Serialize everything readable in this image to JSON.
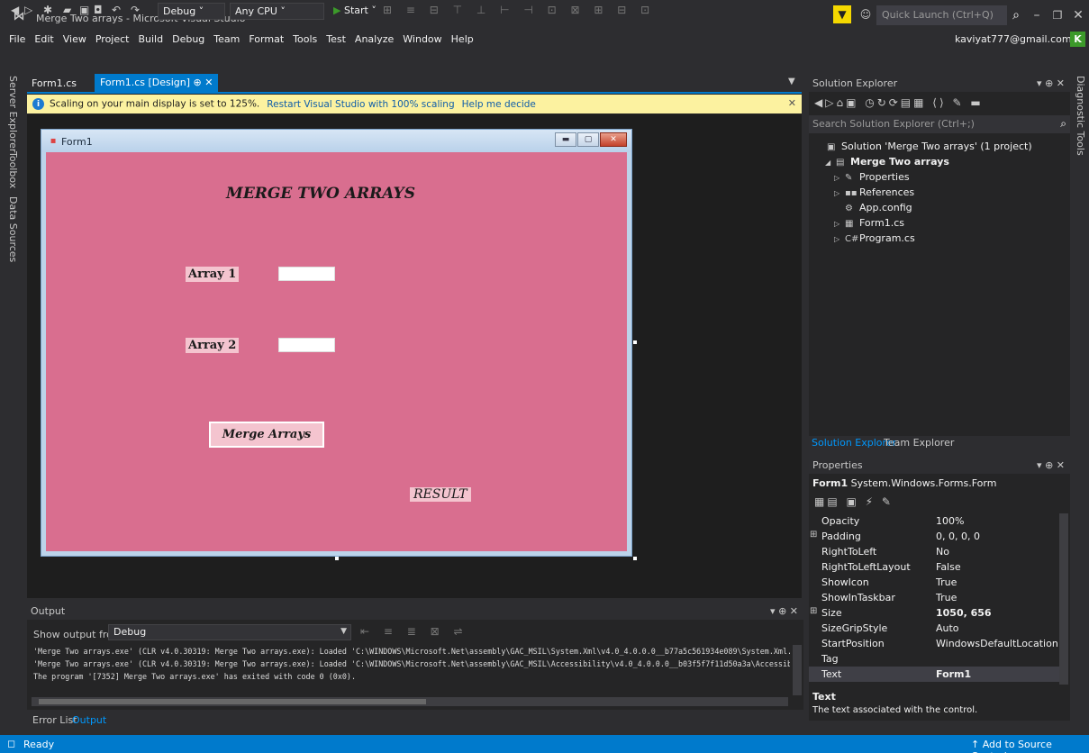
{
  "window": {
    "title": "Merge Two arrays - Microsoft Visual Studio",
    "quick_launch_placeholder": "Quick Launch (Ctrl+Q)",
    "account": "kaviyat777@gmail.com",
    "account_initial": "K"
  },
  "menu": [
    "File",
    "Edit",
    "View",
    "Project",
    "Build",
    "Debug",
    "Team",
    "Format",
    "Tools",
    "Test",
    "Analyze",
    "Window",
    "Help"
  ],
  "toolbar": {
    "configuration": "Debug",
    "platform": "Any CPU",
    "start_label": "Start"
  },
  "side_tabs_left": [
    "Server Explorer",
    "Toolbox",
    "Data Sources"
  ],
  "side_tabs_right": [
    "Diagnostic Tools"
  ],
  "document_tabs": [
    {
      "label": "Form1.cs",
      "active": false
    },
    {
      "label": "Form1.cs [Design]",
      "active": true
    }
  ],
  "infobar": {
    "message": "Scaling on your main display is set to 125%.",
    "link1": "Restart Visual Studio with 100% scaling",
    "link2": "Help me decide"
  },
  "form": {
    "title": "Form1",
    "heading": "MERGE TWO ARRAYS",
    "label_array1": "Array 1",
    "label_array2": "Array 2",
    "textbox1_value": "",
    "textbox2_value": "",
    "merge_button": "Merge Arrays",
    "result_label": "RESULT"
  },
  "output": {
    "title": "Output",
    "show_from_label": "Show output from:",
    "source": "Debug",
    "lines": [
      "'Merge Two arrays.exe' (CLR v4.0.30319: Merge Two arrays.exe): Loaded 'C:\\WINDOWS\\Microsoft.Net\\assembly\\GAC_MSIL\\System.Xml\\v4.0_4.0.0.0__b77a5c561934e089\\System.Xml.",
      "'Merge Two arrays.exe' (CLR v4.0.30319: Merge Two arrays.exe): Loaded 'C:\\WINDOWS\\Microsoft.Net\\assembly\\GAC_MSIL\\Accessibility\\v4.0_4.0.0.0__b03f5f7f11d50a3a\\Accessib",
      "The program '[7352] Merge Two arrays.exe' has exited with code 0 (0x0)."
    ]
  },
  "bottom_tabs": [
    "Error List",
    "Output"
  ],
  "solution_explorer": {
    "title": "Solution Explorer",
    "search_placeholder": "Search Solution Explorer (Ctrl+;)",
    "tree": [
      {
        "label": "Solution 'Merge Two arrays' (1 project)",
        "icon": "solution-icon",
        "level": 0,
        "arrow": ""
      },
      {
        "label": "Merge Two arrays",
        "icon": "csharp-project-icon",
        "level": 1,
        "arrow": "expanded"
      },
      {
        "label": "Properties",
        "icon": "wrench-icon",
        "level": 2,
        "arrow": "collapsed"
      },
      {
        "label": "References",
        "icon": "references-icon",
        "level": 2,
        "arrow": "collapsed"
      },
      {
        "label": "App.config",
        "icon": "config-file-icon",
        "level": 2,
        "arrow": ""
      },
      {
        "label": "Form1.cs",
        "icon": "form-icon",
        "level": 2,
        "arrow": "collapsed"
      },
      {
        "label": "Program.cs",
        "icon": "csharp-file-icon",
        "level": 2,
        "arrow": "collapsed"
      }
    ],
    "tabs": [
      "Solution Explorer",
      "Team Explorer"
    ]
  },
  "properties": {
    "title": "Properties",
    "object_name": "Form1",
    "object_type": "System.Windows.Forms.Form",
    "rows": [
      {
        "name": "Opacity",
        "value": "100%",
        "expand": ""
      },
      {
        "name": "Padding",
        "value": "0, 0, 0, 0",
        "expand": "plus"
      },
      {
        "name": "RightToLeft",
        "value": "No",
        "expand": ""
      },
      {
        "name": "RightToLeftLayout",
        "value": "False",
        "expand": ""
      },
      {
        "name": "ShowIcon",
        "value": "True",
        "expand": ""
      },
      {
        "name": "ShowInTaskbar",
        "value": "True",
        "expand": ""
      },
      {
        "name": "Size",
        "value": "1050, 656",
        "expand": "plus",
        "bold": true
      },
      {
        "name": "SizeGripStyle",
        "value": "Auto",
        "expand": ""
      },
      {
        "name": "StartPosition",
        "value": "WindowsDefaultLocation",
        "expand": ""
      },
      {
        "name": "Tag",
        "value": "",
        "expand": ""
      },
      {
        "name": "Text",
        "value": "Form1",
        "expand": "",
        "bold": true,
        "selected": true
      }
    ],
    "description_title": "Text",
    "description_text": "The text associated with the control."
  },
  "status": {
    "text": "Ready",
    "source_control": "Add to Source Control"
  }
}
